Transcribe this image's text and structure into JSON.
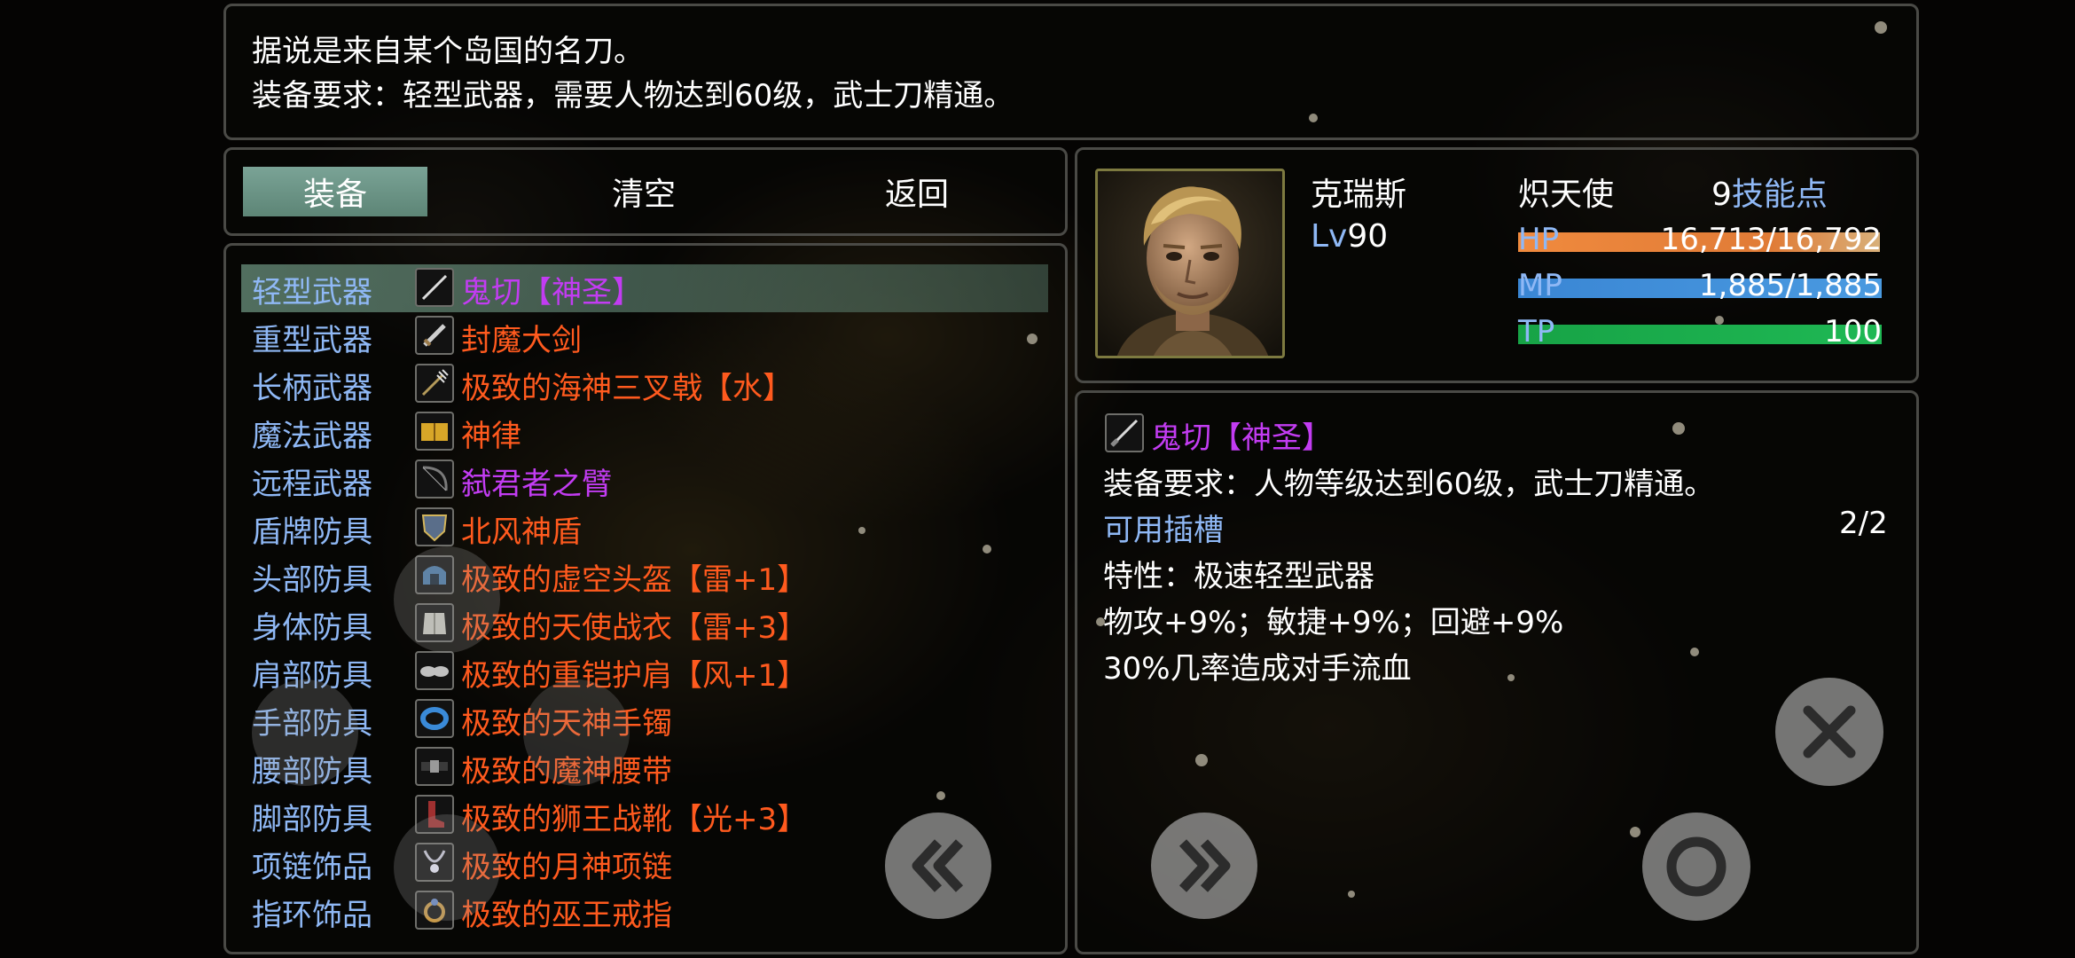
{
  "description": {
    "line1": "据说是来自某个岛国的名刀。",
    "line2": "装备要求：轻型武器，需要人物达到60级，武士刀精通。"
  },
  "tabs": [
    {
      "label": "装备",
      "active": true
    },
    {
      "label": "清空",
      "active": false
    },
    {
      "label": "返回",
      "active": false
    }
  ],
  "slots": [
    {
      "slot": "轻型武器",
      "item": "鬼切【神圣】",
      "color": "#c23cf2",
      "icon": "katana-icon",
      "selected": true
    },
    {
      "slot": "重型武器",
      "item": "封魔大剑",
      "color": "#ff5a1e",
      "icon": "greatsword-icon",
      "selected": false
    },
    {
      "slot": "长柄武器",
      "item": "极致的海神三叉戟【水】",
      "color": "#ff5a1e",
      "icon": "trident-icon",
      "selected": false
    },
    {
      "slot": "魔法武器",
      "item": "神律",
      "color": "#ff5a1e",
      "icon": "spellbook-icon",
      "selected": false
    },
    {
      "slot": "远程武器",
      "item": "弑君者之臂",
      "color": "#c23cf2",
      "icon": "bow-icon",
      "selected": false
    },
    {
      "slot": "盾牌防具",
      "item": "北风神盾",
      "color": "#ff5a1e",
      "icon": "shield-icon",
      "selected": false
    },
    {
      "slot": "头部防具",
      "item": "极致的虚空头盔【雷+1】",
      "color": "#ff5a1e",
      "icon": "helmet-icon",
      "selected": false
    },
    {
      "slot": "身体防具",
      "item": "极致的天使战衣【雷+3】",
      "color": "#ff5a1e",
      "icon": "armor-icon",
      "selected": false
    },
    {
      "slot": "肩部防具",
      "item": "极致的重铠护肩【风+1】",
      "color": "#ff5a1e",
      "icon": "pauldron-icon",
      "selected": false
    },
    {
      "slot": "手部防具",
      "item": "极致的天神手镯",
      "color": "#ff5a1e",
      "icon": "bracelet-icon",
      "selected": false
    },
    {
      "slot": "腰部防具",
      "item": "极致的魔神腰带",
      "color": "#ff5a1e",
      "icon": "belt-icon",
      "selected": false
    },
    {
      "slot": "脚部防具",
      "item": "极致的狮王战靴【光+3】",
      "color": "#ff5a1e",
      "icon": "boots-icon",
      "selected": false
    },
    {
      "slot": "项链饰品",
      "item": "极致的月神项链",
      "color": "#ff5a1e",
      "icon": "necklace-icon",
      "selected": false
    },
    {
      "slot": "指环饰品",
      "item": "极致的巫王戒指",
      "color": "#ff5a1e",
      "icon": "ring-icon",
      "selected": false
    }
  ],
  "character": {
    "name": "克瑞斯",
    "class": "炽天使",
    "skill_points_value": "9",
    "skill_points_label": "技能点",
    "level_label": "Lv",
    "level_value": "90",
    "hp_label": "HP",
    "hp_text": "16,713/16,792",
    "hp_fraction": 0.995,
    "mp_label": "MP",
    "mp_text": "1,885/1,885",
    "mp_fraction": 1.0,
    "tp_label": "TP",
    "tp_text": "100",
    "tp_fraction": 1.0
  },
  "item_detail": {
    "name": "鬼切【神圣】",
    "requirement": "装备要求：人物等级达到60级，武士刀精通。",
    "slots_label": "可用插槽",
    "slots_value": "2/2",
    "trait": "特性：极速轻型武器",
    "stats": "物攻+9%；敏捷+9%；回避+9%",
    "effect": "30%几率造成对手流血"
  },
  "colors": {
    "accent_blue": "#8fb8f5",
    "legendary": "#ff5a1e",
    "epic": "#c23cf2",
    "hp": "#e8873a",
    "mp": "#3f8fd8",
    "tp": "#1aa64a"
  }
}
